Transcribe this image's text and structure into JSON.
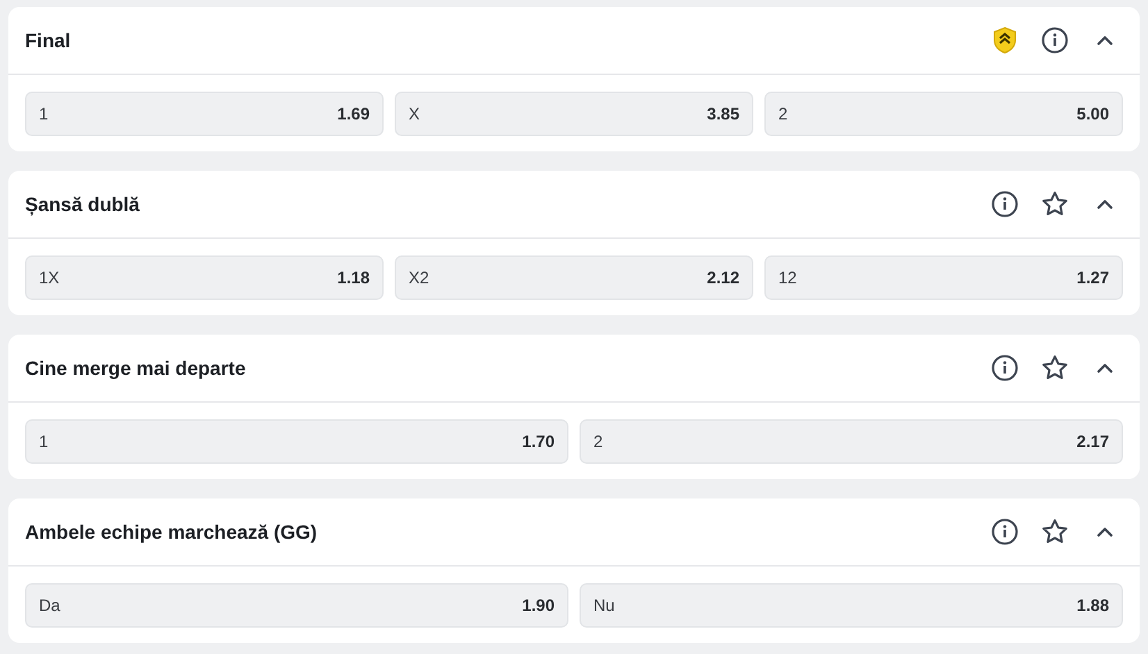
{
  "markets": [
    {
      "title": "Final",
      "kind": "boosted",
      "expanded": true,
      "outcomes": [
        {
          "label": "1",
          "odds": "1.69"
        },
        {
          "label": "X",
          "odds": "3.85"
        },
        {
          "label": "2",
          "odds": "5.00"
        }
      ]
    },
    {
      "title": "Șansă dublă",
      "kind": "standard",
      "expanded": true,
      "outcomes": [
        {
          "label": "1X",
          "odds": "1.18"
        },
        {
          "label": "X2",
          "odds": "2.12"
        },
        {
          "label": "12",
          "odds": "1.27"
        }
      ]
    },
    {
      "title": "Cine merge mai departe",
      "kind": "standard",
      "expanded": true,
      "outcomes": [
        {
          "label": "1",
          "odds": "1.70"
        },
        {
          "label": "2",
          "odds": "2.17"
        }
      ]
    },
    {
      "title": "Ambele echipe marchează (GG)",
      "kind": "standard",
      "expanded": true,
      "outcomes": [
        {
          "label": "Da",
          "odds": "1.90"
        },
        {
          "label": "Nu",
          "odds": "1.88"
        }
      ]
    }
  ]
}
